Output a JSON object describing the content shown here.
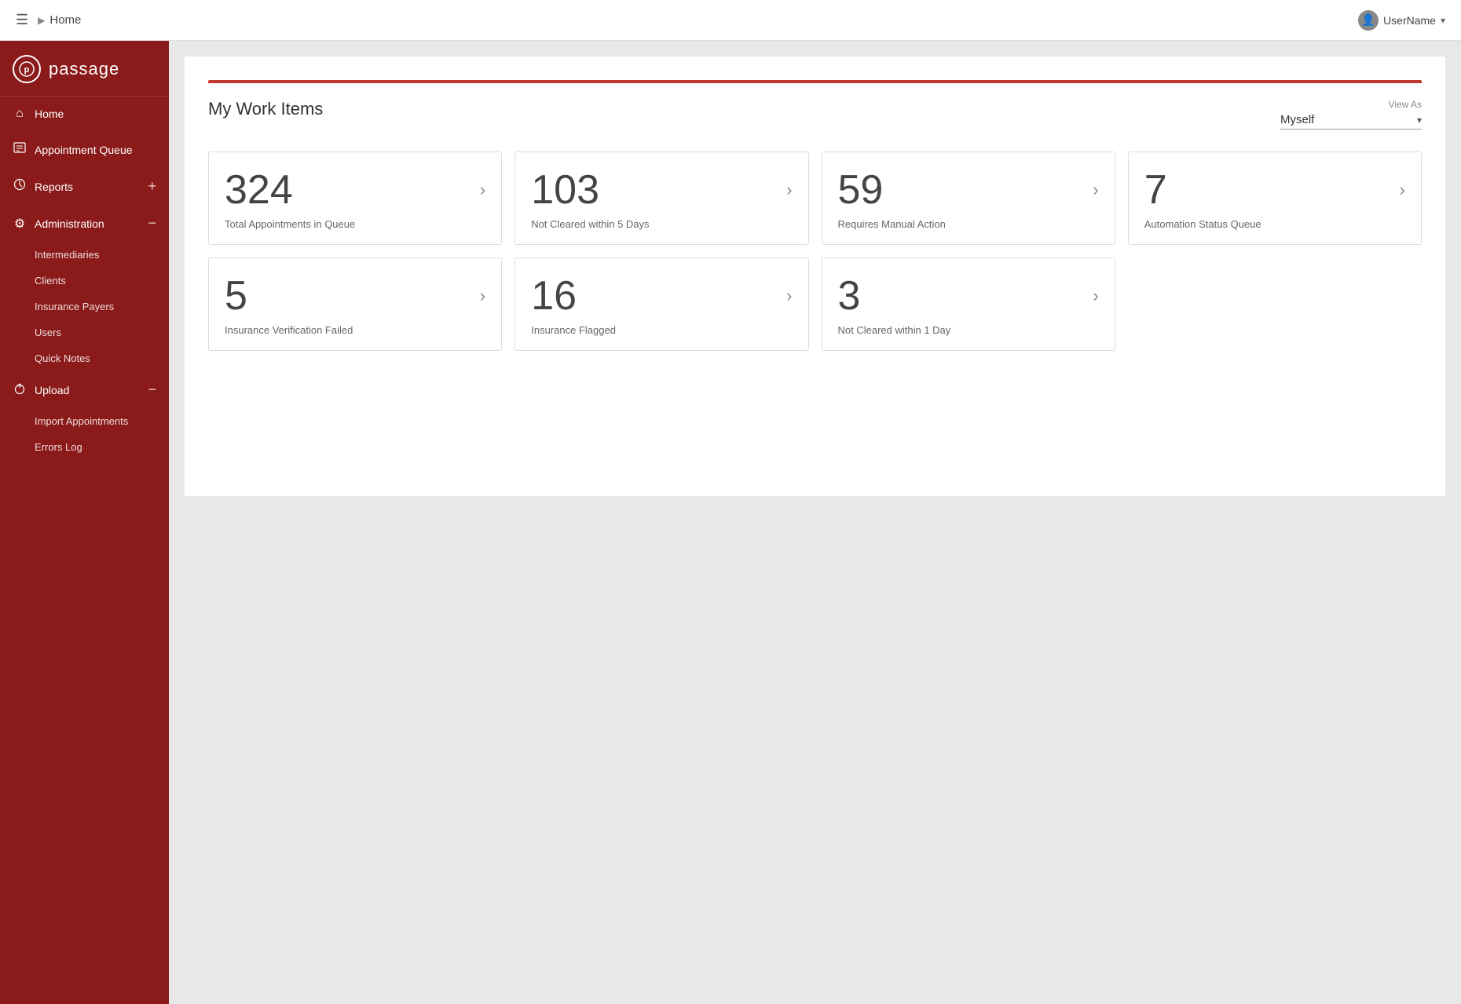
{
  "header": {
    "breadcrumb_arrow": "▶",
    "home_label": "Home",
    "username": "UserName",
    "chevron": "▾"
  },
  "logo": {
    "symbol": "p",
    "text": "passage"
  },
  "sidebar": {
    "items": [
      {
        "id": "home",
        "label": "Home",
        "icon": "⌂",
        "has_plus": false,
        "has_minus": false
      },
      {
        "id": "appointment-queue",
        "label": "Appointment Queue",
        "icon": "📋",
        "has_plus": false,
        "has_minus": false
      },
      {
        "id": "reports",
        "label": "Reports",
        "icon": "🕐",
        "has_plus": true,
        "has_minus": false
      },
      {
        "id": "administration",
        "label": "Administration",
        "icon": "⚙",
        "has_plus": false,
        "has_minus": true
      }
    ],
    "admin_subitems": [
      "Intermediaries",
      "Clients",
      "Insurance Payers",
      "Users",
      "Quick Notes"
    ],
    "upload": {
      "label": "Upload",
      "icon": "⬆",
      "has_minus": true
    },
    "upload_subitems": [
      "Import Appointments",
      "Errors Log"
    ]
  },
  "main": {
    "title": "My Work Items",
    "view_as_label": "View As",
    "view_as_value": "Myself",
    "cards_row1": [
      {
        "number": "324",
        "label": "Total Appointments in Queue"
      },
      {
        "number": "103",
        "label": "Not Cleared within 5 Days"
      },
      {
        "number": "59",
        "label": "Requires Manual Action"
      },
      {
        "number": "7",
        "label": "Automation Status Queue"
      }
    ],
    "cards_row2": [
      {
        "number": "5",
        "label": "Insurance Verification Failed"
      },
      {
        "number": "16",
        "label": "Insurance Flagged"
      },
      {
        "number": "3",
        "label": "Not Cleared within 1 Day"
      },
      {
        "empty": true
      }
    ]
  }
}
